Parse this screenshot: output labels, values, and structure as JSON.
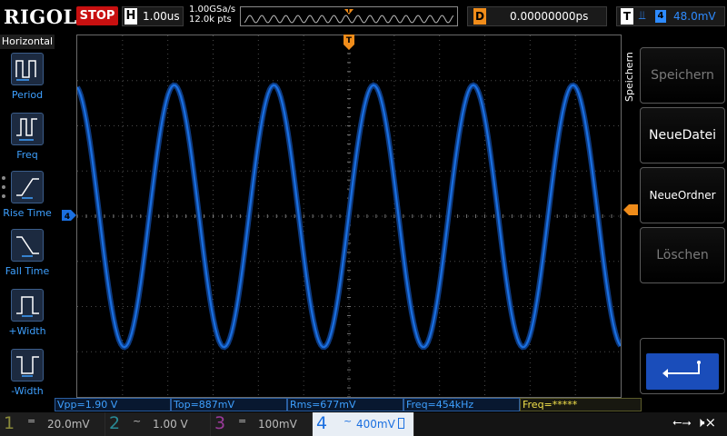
{
  "header": {
    "logo": "RIGOL",
    "run_state": "STOP",
    "timebase_label": "H",
    "timebase_value": "1.00us",
    "sample_rate": "1.00GSa/s",
    "memory_points": "12.0k pts",
    "memory_trigger_marker": "T",
    "trigger_pos_label": "D",
    "trigger_pos_value": "0.00000000ps",
    "trigger_label": "T",
    "trigger_source": "4",
    "trigger_level": "48.0mV"
  },
  "left_menu": {
    "title": "Horizontal",
    "items": [
      {
        "label": "Period"
      },
      {
        "label": "Freq"
      },
      {
        "label": "Rise Time"
      },
      {
        "label": "Fall Time"
      },
      {
        "label": "+Width"
      },
      {
        "label": "-Width"
      }
    ]
  },
  "right_menu": {
    "title": "Speichern",
    "buttons": [
      {
        "label": "Speichern",
        "enabled": false
      },
      {
        "label": "NeueDatei",
        "enabled": true
      },
      {
        "label": "NeueOrdner",
        "enabled": true
      },
      {
        "label": "Löschen",
        "enabled": false
      }
    ]
  },
  "markers": {
    "trigger_top": "T",
    "channel4": "4"
  },
  "measurements": [
    {
      "text": "Vpp=1.90 V"
    },
    {
      "text": "Top=887mV"
    },
    {
      "text": "Rms=677mV"
    },
    {
      "text": "Freq=454kHz"
    },
    {
      "text": "Freq=*****"
    }
  ],
  "channels": [
    {
      "num": "1",
      "coupling": "=",
      "scale": "20.0mV",
      "color": "#f3e24b",
      "active": false
    },
    {
      "num": "2",
      "coupling": "~",
      "scale": "1.00 V",
      "color": "#22d4e6",
      "active": false
    },
    {
      "num": "3",
      "coupling": "=",
      "scale": "100mV",
      "color": "#e040e0",
      "active": false
    },
    {
      "num": "4",
      "coupling": "~",
      "scale": "400mV",
      "color": "#1a6fe0",
      "active": true
    }
  ],
  "waveform": {
    "channel": "4",
    "color": "#1a6fe0",
    "cycles_on_screen": 5.45,
    "amplitude_divisions": 2.9,
    "offset_divisions": 0,
    "phase_deg": 100
  },
  "colors": {
    "accent_blue": "#2e8bff",
    "trigger_orange": "#f08c1a",
    "stop_red": "#c81010",
    "grid": "#4a4a4a"
  }
}
